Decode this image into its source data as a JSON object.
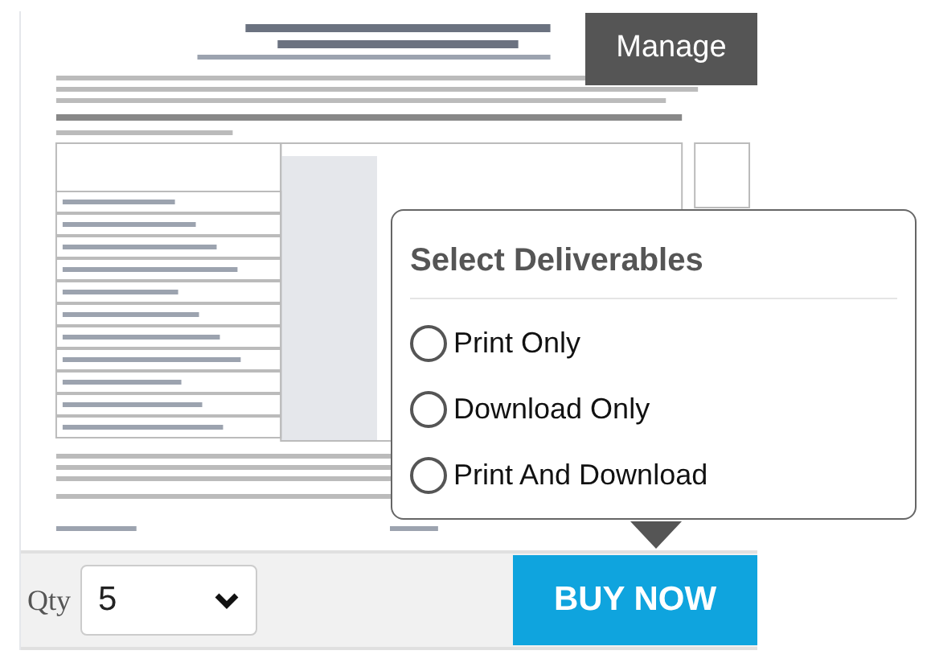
{
  "manage_button": "Manage",
  "deliverables_popup": {
    "title": "Select Deliverables",
    "options": [
      {
        "label": "Print Only",
        "selected": false
      },
      {
        "label": "Download Only",
        "selected": false
      },
      {
        "label": "Print And Download",
        "selected": false
      }
    ]
  },
  "quantity": {
    "label": "Qty",
    "value": "5"
  },
  "buy_button": "BUY NOW"
}
